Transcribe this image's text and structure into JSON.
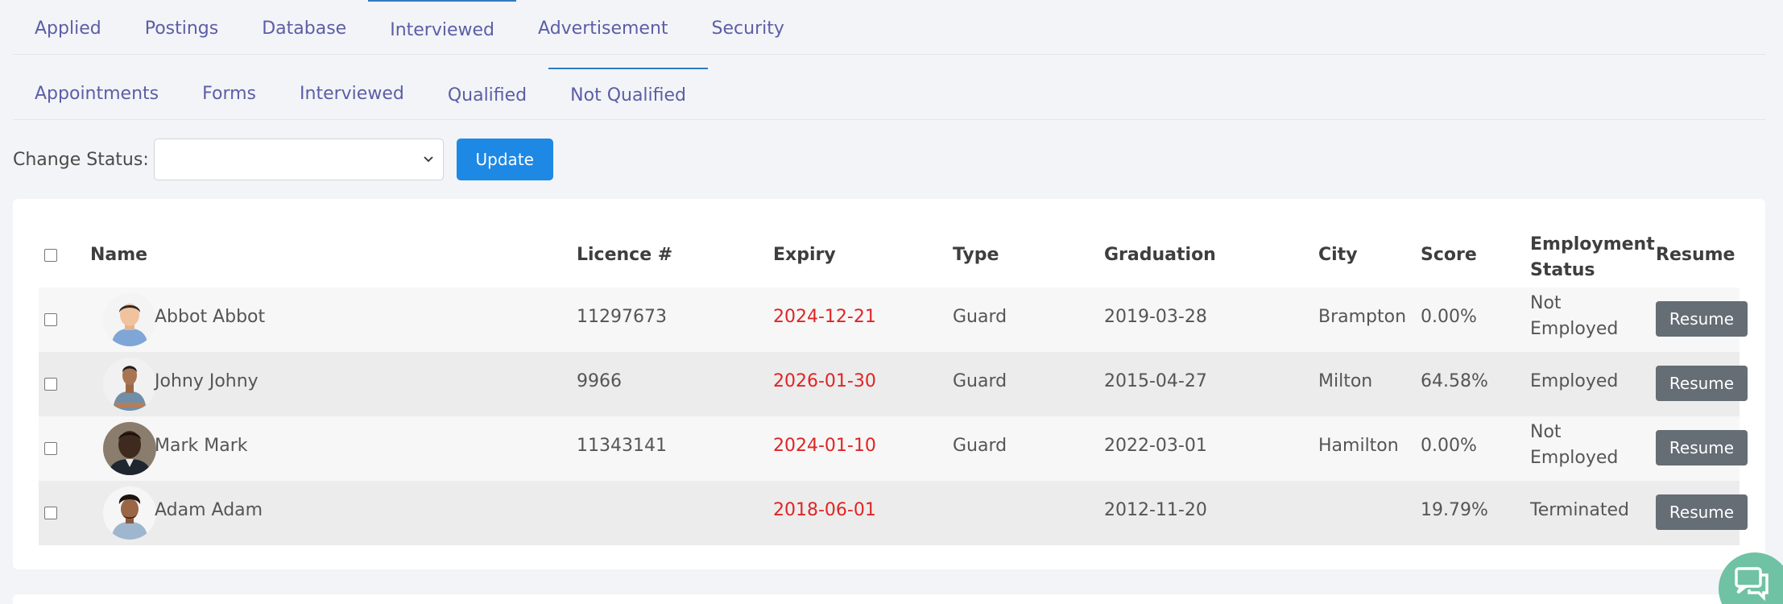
{
  "tabs": {
    "main": [
      "Applied",
      "Postings",
      "Database",
      "Interviewed",
      "Advertisement",
      "Security"
    ],
    "sub": [
      "Appointments",
      "Forms",
      "Interviewed",
      "Qualified",
      "Not Qualified"
    ]
  },
  "status": {
    "label": "Change Status:",
    "selected": "",
    "button": "Update"
  },
  "table": {
    "headers": [
      "Name",
      "Licence #",
      "Expiry",
      "Type",
      "Graduation",
      "City",
      "Score",
      "Employment Status",
      "Resume"
    ],
    "rows": [
      {
        "name": "Abbot Abbot",
        "licence": "11297673",
        "expiry": "2024-12-21",
        "type": "Guard",
        "graduation": "2019-03-28",
        "city": "Brampton",
        "score": "0.00%",
        "employment": [
          "Not",
          "Employed"
        ],
        "resume": "Resume"
      },
      {
        "name": "Johny Johny",
        "licence": "9966",
        "expiry": "2026-01-30",
        "type": "Guard",
        "graduation": "2015-04-27",
        "city": "Milton",
        "score": "64.58%",
        "employment": [
          "Employed",
          ""
        ],
        "resume": "Resume"
      },
      {
        "name": "Mark Mark",
        "licence": "11343141",
        "expiry": "2024-01-10",
        "type": "Guard",
        "graduation": "2022-03-01",
        "city": "Hamilton",
        "score": "0.00%",
        "employment": [
          "Not",
          "Employed"
        ],
        "resume": "Resume"
      },
      {
        "name": "Adam Adam",
        "licence": "",
        "expiry": "2018-06-01",
        "type": "",
        "graduation": "2012-11-20",
        "city": "",
        "score": "19.79%",
        "employment": [
          "Terminated",
          ""
        ],
        "resume": "Resume"
      }
    ]
  },
  "colors": {
    "tab_text": "#5b5ea6",
    "active_tab_bar": "#2f7bc4",
    "update_button": "#1e88e5",
    "expiry_text": "#e02424",
    "resume_button": "#656d75",
    "chat_button": "#6fc2a4"
  },
  "icons": {
    "select": "chevron-down-icon",
    "chat": "chat-icon",
    "avatars": "person-avatar"
  }
}
